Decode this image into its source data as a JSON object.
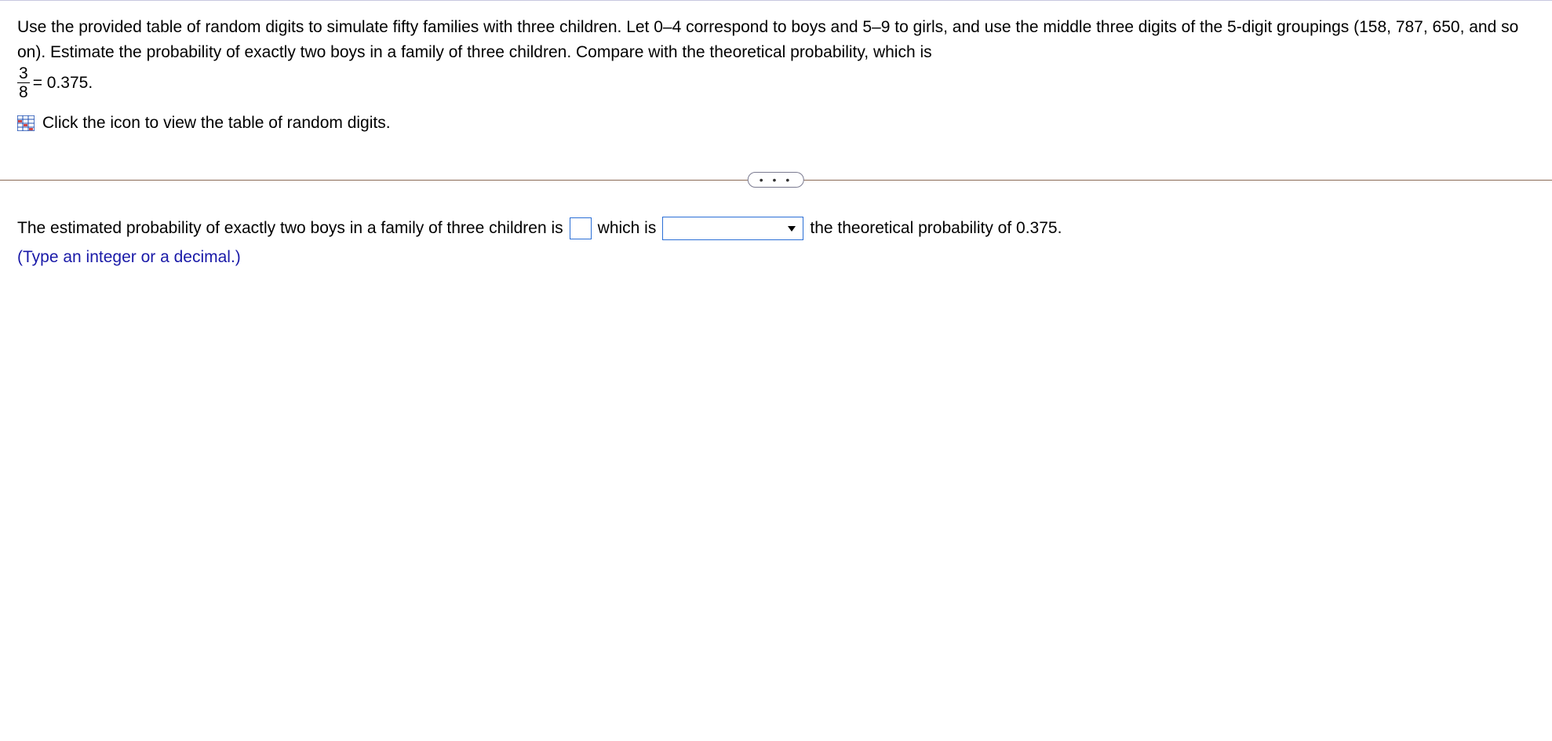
{
  "question": {
    "para1_a": "Use the provided table of random digits to simulate fifty families with three children. Let 0–4 correspond to boys and 5–9 to girls, and use the middle three digits of the 5-digit groupings (158, 787, 650, and so on). Estimate the probability of exactly two boys in a family of three children. Compare with the theoretical probability, which is",
    "frac_num": "3",
    "frac_den": "8",
    "para1_b": "= 0.375.",
    "click_text": "Click the icon to view the table of random digits."
  },
  "divider_dots": "• • •",
  "answer": {
    "before_input": "The estimated probability of exactly two boys in a family of three children is",
    "between": "which is",
    "after_dropdown": "the theoretical probability of 0.375.",
    "hint": "(Type an integer or a decimal.)"
  }
}
